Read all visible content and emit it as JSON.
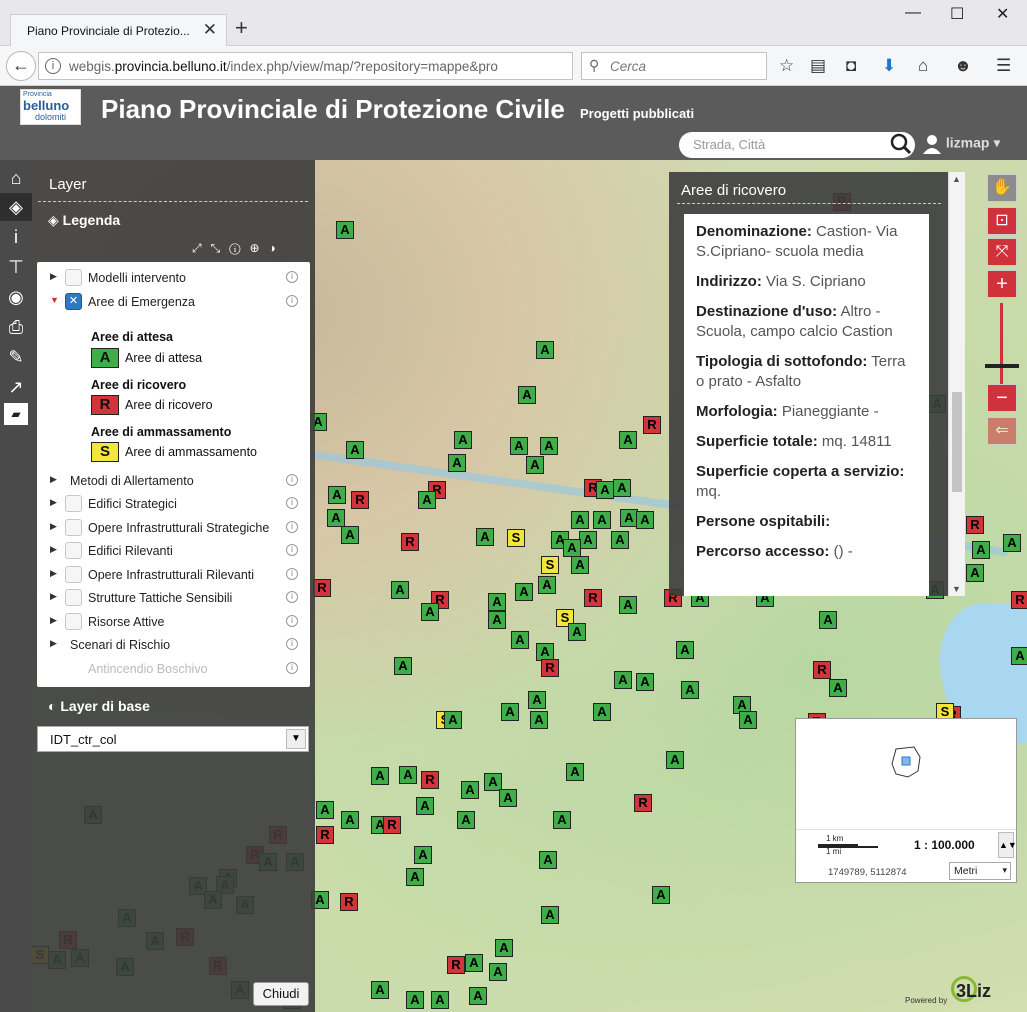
{
  "browser": {
    "tab_title": "Piano Provinciale di Protezio...",
    "tab_close": "✕",
    "new_tab": "+",
    "win_min": "—",
    "win_max": "☐",
    "win_close": "✕",
    "url_prefix": "webgis.",
    "url_domain": "provincia.belluno.it",
    "url_path": "/index.php/view/map/?repository=mappe&pro",
    "search_placeholder": "Cerca"
  },
  "header": {
    "logo_small": "Provincia",
    "logo_main": "belluno",
    "logo_sub": "dolomiti",
    "title": "Piano Provinciale di Protezione Civile",
    "subtitle": "Progetti pubblicati",
    "search_placeholder": "Strada, Città",
    "user": "lizmap ▾"
  },
  "layers": {
    "title": "Layer",
    "legend_header": "Legenda",
    "base_header": "Layer di base",
    "base_selected": "IDT_ctr_col",
    "close_label": "Chiudi",
    "tree": [
      {
        "label": "Modelli intervento"
      },
      {
        "label": "Aree di Emergenza"
      },
      {
        "label": "Metodi di Allertamento"
      },
      {
        "label": "Edifici Strategici"
      },
      {
        "label": "Opere Infrastrutturali Strategiche"
      },
      {
        "label": "Edifici Rilevanti"
      },
      {
        "label": "Opere Infrastrutturali Rilevanti"
      },
      {
        "label": "Strutture Tattiche Sensibili"
      },
      {
        "label": "Risorse Attive"
      },
      {
        "label": "Scenari di Rischio"
      },
      {
        "label": "Antincendio Boschivo"
      }
    ],
    "legend_groups": [
      {
        "group": "Aree di attesa",
        "symbol": "A",
        "item": "Aree di attesa"
      },
      {
        "group": "Aree di ricovero",
        "symbol": "R",
        "item": "Aree di ricovero"
      },
      {
        "group": "Aree di ammassamento",
        "symbol": "S",
        "item": "Aree di ammassamento"
      }
    ]
  },
  "popup": {
    "title": "Aree di ricovero",
    "fields": [
      {
        "label": "Denominazione:",
        "value": "Castion- Via S.Cipriano- scuola media"
      },
      {
        "label": "Indirizzo:",
        "value": "Via S. Cipriano"
      },
      {
        "label": "Destinazione d'uso:",
        "value": "Altro - Scuola, campo calcio Castion"
      },
      {
        "label": "Tipologia di sottofondo:",
        "value": "Terra o prato - Asfalto"
      },
      {
        "label": "Morfologia:",
        "value": "Pianeggiante -"
      },
      {
        "label": "Superficie totale:",
        "value": "mq. 14811"
      },
      {
        "label": "Superficie coperta a servizio:",
        "value": "mq."
      },
      {
        "label": "Persone ospitabili:",
        "value": ""
      },
      {
        "label": "Percorso accesso:",
        "value": "() -"
      }
    ]
  },
  "overview": {
    "scale_km": "1 km",
    "scale_mi": "1 mi",
    "scale_ratio": "1 : 100.000",
    "coords": "1749789, 5112874",
    "unit": "Metri"
  },
  "footer": {
    "powered_by": "Powered by",
    "liz": "3Liz"
  }
}
